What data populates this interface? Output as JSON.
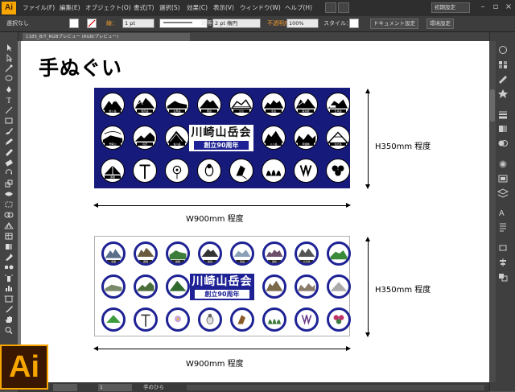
{
  "app": {
    "name": "Illustrator",
    "logo_text": "Ai"
  },
  "menubar": {
    "items": [
      "ファイル(F)",
      "編集(E)",
      "オブジェクト(O)",
      "書式(T)",
      "選択(S)",
      "効果(C)",
      "表示(V)",
      "ウィンドウ(W)",
      "ヘルプ(H)"
    ],
    "workspace": "初期設定",
    "window_controls": [
      "minimize-icon",
      "maximize-icon",
      "close-icon"
    ]
  },
  "control_bar": {
    "selection": "選択なし",
    "stroke_label": "線：",
    "stroke_value": "1 pt",
    "profile_label": "均等",
    "brush_value": "2 pt 楕円",
    "opacity_label": "不透明度：",
    "opacity_value": "100%",
    "style_label": "スタイル：",
    "doc_setup": "ドキュメント設定",
    "preferences": "環境設定"
  },
  "document_tab": {
    "label": "1185_B/T_RGBプレビュー (RGB/プレビュー)"
  },
  "canvas": {
    "title": "手ぬぐい",
    "mockup_top": {
      "logo_line1": "川崎山岳会",
      "logo_line2": "創立90周年",
      "height_label": "H350mm 程度",
      "width_label": "W900mm 程度"
    },
    "mockup_bottom": {
      "logo_line1": "川崎山岳会",
      "logo_line2": "創立90周年",
      "height_label": "H350mm 程度",
      "width_label": "W900mm 程度"
    },
    "circle_labels": [
      "槍ヶ岳",
      "穂高岳",
      "白馬岳",
      "剱岳",
      "立山",
      "北岳",
      "鹿島槍",
      "五竜岳",
      "雲取山",
      "丹沢",
      "谷川岳",
      "八ヶ岳",
      "甲斐駒",
      "仙丈岳",
      "奥穂",
      "北穂",
      "西穂",
      "前穂",
      "常念",
      "燕岳",
      "唐松",
      "大天井"
    ]
  },
  "colors": {
    "towel_navy": "#161a7a",
    "circle_ring_blue": "#1e2294",
    "ai_orange": "#f7a600"
  },
  "statusbar": {
    "zoom": "",
    "page": "1",
    "tool_status": "手のひら"
  }
}
